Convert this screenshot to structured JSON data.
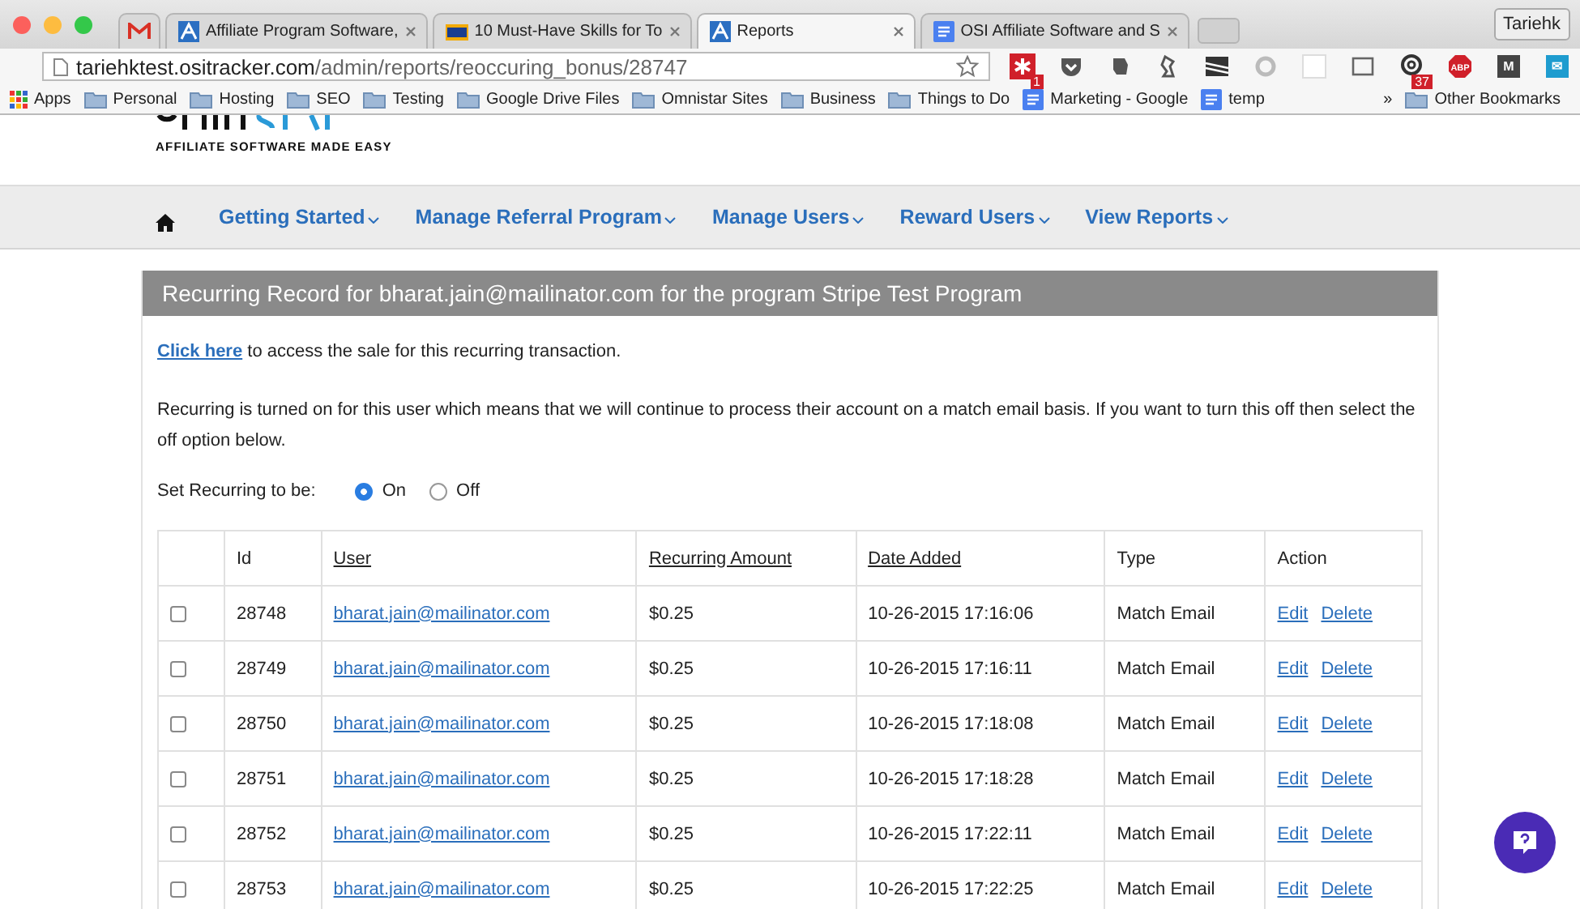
{
  "browser": {
    "tabs": [
      {
        "kind": "gmail",
        "selected": false
      },
      {
        "kind": "site",
        "title": "Affiliate Program Software,",
        "selected": false
      },
      {
        "kind": "mta",
        "title": "10 Must-Have Skills for To",
        "selected": false
      },
      {
        "kind": "site",
        "title": "Reports",
        "selected": true
      },
      {
        "kind": "doc",
        "title": "OSI Affiliate Software and S",
        "selected": false
      }
    ],
    "profile": "Tariehk",
    "url_host": "tariehktest.ositracker.com",
    "url_path": "/admin/reports/reoccuring_bonus/28747",
    "extensions": [
      {
        "kind": "asterisk",
        "color": "#d0202a",
        "badge": "1"
      },
      {
        "kind": "pocket",
        "color": "#555555"
      },
      {
        "kind": "elephant",
        "color": "#555555"
      },
      {
        "kind": "lamp",
        "color": "#555555"
      },
      {
        "kind": "stripes",
        "color": "#333333"
      },
      {
        "kind": "ring",
        "color": "#bbbbbb"
      },
      {
        "kind": "blank",
        "color": "#dddddd"
      },
      {
        "kind": "cast",
        "color": "#666666"
      },
      {
        "kind": "at",
        "color": "#333333",
        "badge": "37"
      },
      {
        "kind": "stop",
        "color": "#d0202a",
        "label": "ABP"
      },
      {
        "kind": "tile",
        "color": "#444444",
        "label": "M"
      },
      {
        "kind": "tile",
        "color": "#1e9ccf",
        "label": "✉"
      }
    ],
    "bookmarks": [
      {
        "kind": "apps",
        "label": "Apps"
      },
      {
        "kind": "folder",
        "label": "Personal"
      },
      {
        "kind": "folder",
        "label": "Hosting"
      },
      {
        "kind": "folder",
        "label": "SEO"
      },
      {
        "kind": "folder",
        "label": "Testing"
      },
      {
        "kind": "folder",
        "label": "Google Drive Files"
      },
      {
        "kind": "folder",
        "label": "Omnistar Sites"
      },
      {
        "kind": "folder",
        "label": "Business"
      },
      {
        "kind": "folder",
        "label": "Things to Do"
      },
      {
        "kind": "doc",
        "label": "Marketing -  Google"
      },
      {
        "kind": "doc",
        "label": "temp"
      }
    ],
    "more": "»",
    "other": "Other Bookmarks"
  },
  "site": {
    "tagline": "AFFILIATE SOFTWARE MADE EASY",
    "nav": [
      "Getting Started",
      "Manage Referral Program",
      "Manage Users",
      "Reward Users",
      "View Reports"
    ]
  },
  "panel": {
    "title": "Recurring Record for bharat.jain@mailinator.com for the program Stripe Test Program",
    "link": "Click here",
    "link_text": " to access the sale for this recurring transaction.",
    "notice": "Recurring is turned on for this user which means that we will continue to process their account on a match email basis. If you want to turn this off then select the off option below.",
    "radio_label": "Set Recurring to be:",
    "options": [
      {
        "label": "On",
        "selected": true
      },
      {
        "label": "Off",
        "selected": false
      }
    ],
    "table": {
      "columns": [
        {
          "label": "Id",
          "sortable": false
        },
        {
          "label": "User",
          "sortable": true
        },
        {
          "label": "Recurring Amount",
          "sortable": true
        },
        {
          "label": "Date Added",
          "sortable": true
        },
        {
          "label": "Type",
          "sortable": false
        },
        {
          "label": "Action",
          "sortable": false
        }
      ],
      "rows": [
        {
          "checked": false,
          "id": "28748",
          "user": "bharat.jain@mailinator.com",
          "amount": "$0.25",
          "date": "10-26-2015 17:16:06",
          "type": "Match Email",
          "actions": [
            "Edit",
            "Delete"
          ]
        },
        {
          "checked": false,
          "id": "28749",
          "user": "bharat.jain@mailinator.com",
          "amount": "$0.25",
          "date": "10-26-2015 17:16:11",
          "type": "Match Email",
          "actions": [
            "Edit",
            "Delete"
          ]
        },
        {
          "checked": false,
          "id": "28750",
          "user": "bharat.jain@mailinator.com",
          "amount": "$0.25",
          "date": "10-26-2015 17:18:08",
          "type": "Match Email",
          "actions": [
            "Edit",
            "Delete"
          ]
        },
        {
          "checked": false,
          "id": "28751",
          "user": "bharat.jain@mailinator.com",
          "amount": "$0.25",
          "date": "10-26-2015 17:18:28",
          "type": "Match Email",
          "actions": [
            "Edit",
            "Delete"
          ]
        },
        {
          "checked": false,
          "id": "28752",
          "user": "bharat.jain@mailinator.com",
          "amount": "$0.25",
          "date": "10-26-2015 17:22:11",
          "type": "Match Email",
          "actions": [
            "Edit",
            "Delete"
          ]
        },
        {
          "checked": false,
          "id": "28753",
          "user": "bharat.jain@mailinator.com",
          "amount": "$0.25",
          "date": "10-26-2015 17:22:25",
          "type": "Match Email",
          "actions": [
            "Edit",
            "Delete"
          ]
        }
      ]
    }
  }
}
